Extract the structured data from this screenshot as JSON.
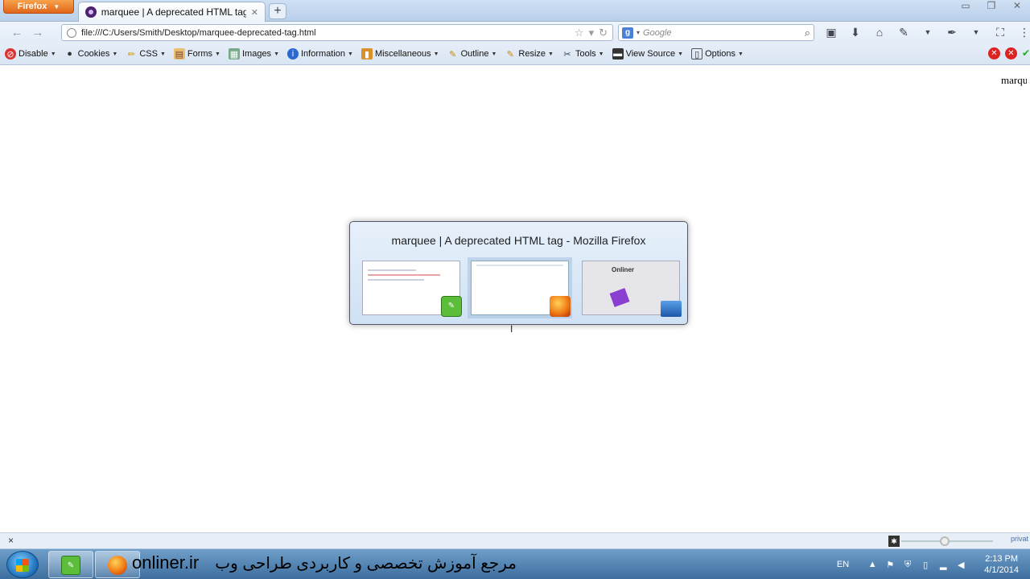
{
  "browser": {
    "app_button": "Firefox",
    "tab_title": "marquee | A deprecated HTML tag",
    "url": "file:///C:/Users/Smith/Desktop/marquee-deprecated-tag.html",
    "search_placeholder": "Google",
    "search_engine_letter": "g"
  },
  "devbar": {
    "items": [
      {
        "label": "Disable",
        "icon": "disable-icon"
      },
      {
        "label": "Cookies",
        "icon": "cookies-icon"
      },
      {
        "label": "CSS",
        "icon": "css-icon"
      },
      {
        "label": "Forms",
        "icon": "forms-icon"
      },
      {
        "label": "Images",
        "icon": "images-icon"
      },
      {
        "label": "Information",
        "icon": "information-icon"
      },
      {
        "label": "Miscellaneous",
        "icon": "miscellaneous-icon"
      },
      {
        "label": "Outline",
        "icon": "outline-icon"
      },
      {
        "label": "Resize",
        "icon": "resize-icon"
      },
      {
        "label": "Tools",
        "icon": "tools-icon"
      },
      {
        "label": "View Source",
        "icon": "view-source-icon"
      },
      {
        "label": "Options",
        "icon": "options-icon"
      }
    ]
  },
  "content": {
    "marquee_text": "marqu"
  },
  "switcher": {
    "title": "marquee | A deprecated HTML tag - Mozilla Firefox",
    "thumbnails": [
      {
        "app": "notepad++"
      },
      {
        "app": "firefox",
        "selected": true
      },
      {
        "app": "onliner"
      }
    ],
    "thumb3_label": "Onliner"
  },
  "statusbar": {
    "close_glyph": "×",
    "privacy_text": "privat"
  },
  "taskbar": {
    "watermark_site": "onliner.ir",
    "watermark_text_fa": "مرجع آموزش تخصصی و کاربردی طراحی وب",
    "lang": "EN",
    "time": "2:13 PM",
    "date": "4/1/2014"
  }
}
